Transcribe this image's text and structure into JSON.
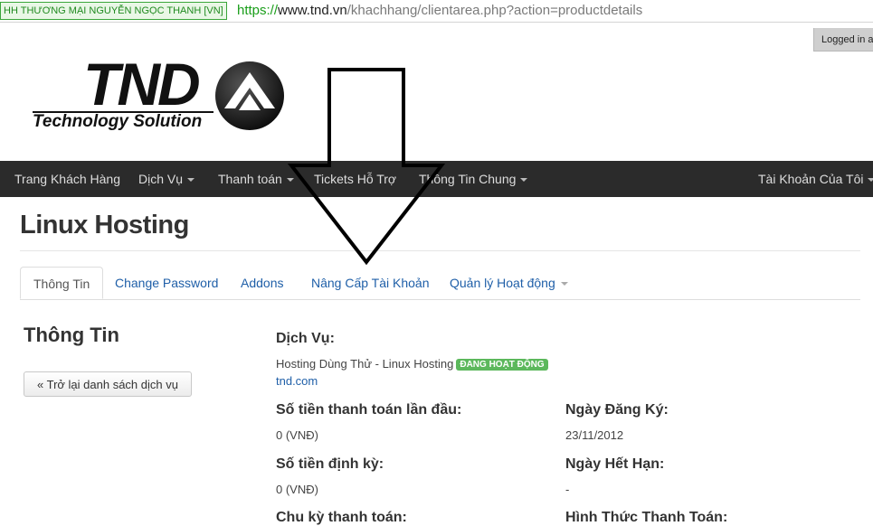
{
  "browser": {
    "ev_certificate": "HH THƯƠNG MẠI NGUYỄN NGỌC THANH [VN]",
    "url_scheme": "https://",
    "url_host": "www.tnd.vn",
    "url_path": "/khachhang/clientarea.php?action=productdetails"
  },
  "header": {
    "logged_in_label": "Logged in as",
    "logo_text": "TND",
    "logo_tagline": "Technology Solution"
  },
  "navbar": {
    "items": [
      {
        "label": "Trang Khách Hàng",
        "has_dropdown": false
      },
      {
        "label": "Dịch Vụ",
        "has_dropdown": true
      },
      {
        "label": "Thanh toán",
        "has_dropdown": true
      },
      {
        "label": "Tickets Hỗ Trợ",
        "has_dropdown": false
      },
      {
        "label": "Thông Tin Chung",
        "has_dropdown": true
      }
    ],
    "account": {
      "label": "Tài Khoản Của Tôi",
      "has_dropdown": true
    }
  },
  "page": {
    "title": "Linux Hosting"
  },
  "tabs": [
    {
      "label": "Thông Tin",
      "active": true
    },
    {
      "label": "Change Password",
      "active": false
    },
    {
      "label": "Addons",
      "active": false
    },
    {
      "label": "Nâng Cấp Tài Khoản",
      "active": false
    },
    {
      "label": "Quản lý Hoạt động",
      "active": false,
      "has_dropdown": true
    }
  ],
  "sidebar": {
    "title": "Thông Tin",
    "back_button": "« Trở lại danh sách dịch vụ"
  },
  "details": {
    "service_label": "Dịch Vụ:",
    "service_name": "Hosting Dùng Thử - Linux Hosting",
    "status_badge": "ĐANG HOẠT ĐỘNG",
    "status_color": "#5cb85c",
    "domain": "tnd.com",
    "first_payment_label": "Số tiền thanh toán lần đầu:",
    "first_payment_value": "0 (VNĐ)",
    "registration_date_label": "Ngày Đăng Ký:",
    "registration_date_value": "23/11/2012",
    "recurring_label": "Số tiền định kỳ:",
    "recurring_value": "0 (VNĐ)",
    "expiry_label": "Ngày Hết Hạn:",
    "expiry_value": "-",
    "billing_cycle_label": "Chu kỳ thanh toán:",
    "payment_method_label": "Hình Thức Thanh Toán:"
  },
  "colors": {
    "navbar_bg": "#2b2b2b",
    "link": "#1f5fa8",
    "ev_green": "#1a9e1a"
  }
}
